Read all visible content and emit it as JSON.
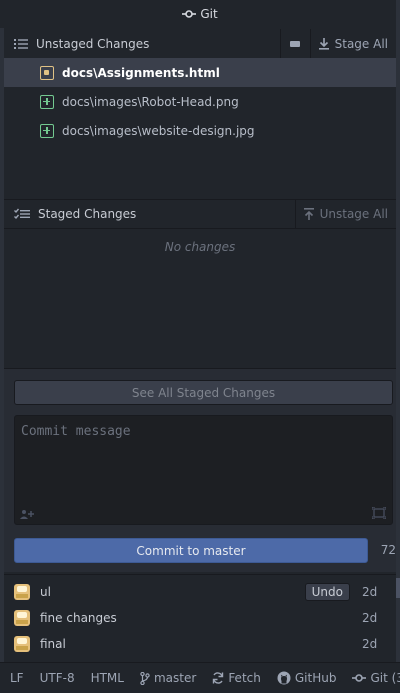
{
  "top_tab": {
    "icon": "git-commit-icon",
    "title": "Git"
  },
  "unstaged": {
    "title": "Unstaged Changes",
    "stage_all_label": "Stage All",
    "files": [
      {
        "path": "docs\\Assignments.html",
        "status": "modified",
        "selected": true
      },
      {
        "path": "docs\\images\\Robot-Head.png",
        "status": "added",
        "selected": false
      },
      {
        "path": "docs\\images\\website-design.jpg",
        "status": "added",
        "selected": false
      }
    ]
  },
  "staged": {
    "title": "Staged Changes",
    "unstage_all_label": "Unstage All",
    "empty_text": "No changes"
  },
  "commit": {
    "see_all_label": "See All Staged Changes",
    "placeholder": "Commit message",
    "button_label": "Commit to master",
    "remaining_chars": "72"
  },
  "recent_commits": [
    {
      "message": "ul",
      "age": "2d",
      "undo_label": "Undo"
    },
    {
      "message": "fine changes",
      "age": "2d"
    },
    {
      "message": "final",
      "age": "2d"
    }
  ],
  "status_bar": {
    "line_ending": "LF",
    "encoding": "UTF-8",
    "grammar": "HTML",
    "branch": "master",
    "fetch": "Fetch",
    "github": "GitHub",
    "git": "Git (3)"
  },
  "colors": {
    "background": "#21252b",
    "selected_row": "#3a3f4b",
    "modified": "#e0c285",
    "added": "#73c990",
    "commit_button": "#4d6aa8"
  }
}
